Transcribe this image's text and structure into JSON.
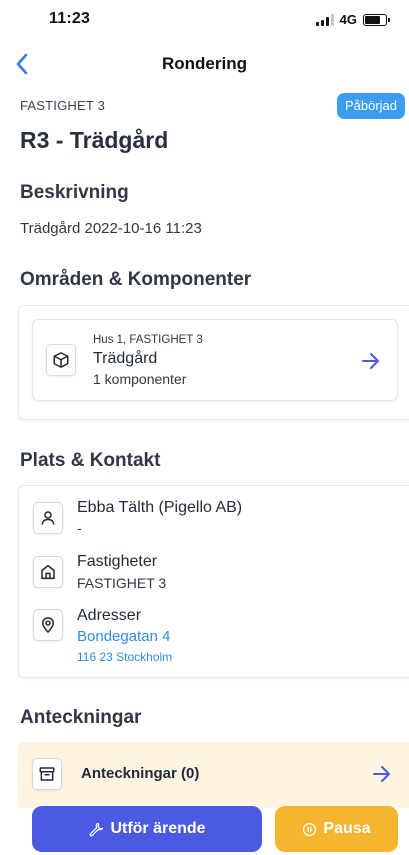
{
  "status_bar": {
    "time": "11:23",
    "network": "4G"
  },
  "nav": {
    "title": "Rondering"
  },
  "header": {
    "property": "FASTIGHET 3",
    "status_badge": "Påbörjad",
    "title": "R3 - Trädgård"
  },
  "description": {
    "heading": "Beskrivning",
    "text": "Trädgård 2022-10-16 11:23"
  },
  "areas": {
    "heading": "Områden & Komponenter",
    "item": {
      "location": "Hus 1, FASTIGHET 3",
      "name": "Trädgård",
      "components": "1 komponenter",
      "icon": "cube-icon"
    }
  },
  "contact": {
    "heading": "Plats & Kontakt",
    "person": {
      "name": "Ebba Tälth (Pigello AB)",
      "detail": "-",
      "icon": "user-icon"
    },
    "properties": {
      "label": "Fastigheter",
      "value": "FASTIGHET 3",
      "icon": "home-icon"
    },
    "address": {
      "label": "Adresser",
      "street": "Bondegatan 4",
      "postal": "116 23 Stockholm",
      "icon": "map-pin-icon"
    }
  },
  "notes": {
    "heading": "Anteckningar",
    "label": "Anteckningar (0)",
    "icon": "archive-icon"
  },
  "actions": {
    "primary_label": "Utför ärende",
    "pause_label": "Pausa"
  },
  "colors": {
    "accent": "#4b5ae0",
    "link": "#2f8de4",
    "badge": "#3b9cf0",
    "pause": "#f5b52e",
    "notes_bg": "#fdf4e2"
  }
}
